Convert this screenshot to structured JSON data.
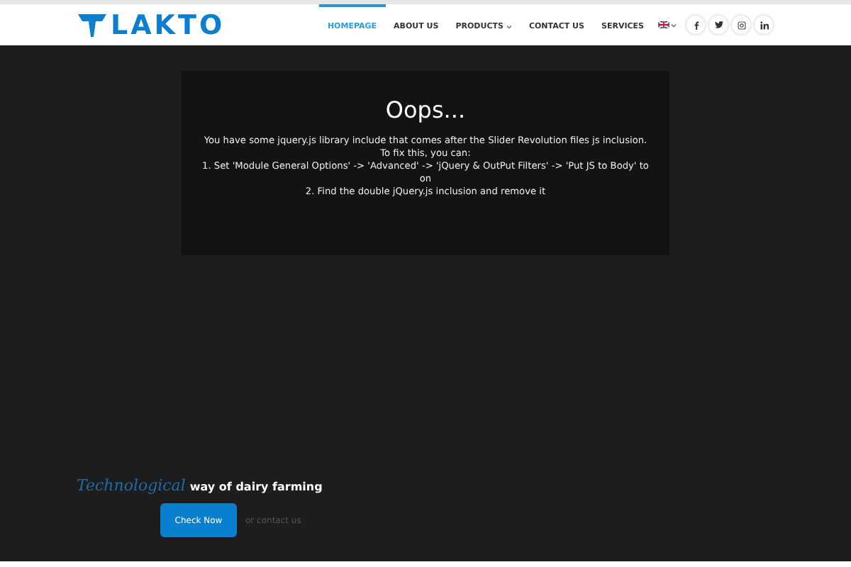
{
  "logo": {
    "text": "LAKTO"
  },
  "nav": [
    {
      "label": "HOMEPAGE",
      "selected": true,
      "dropdown": false
    },
    {
      "label": "ABOUT US",
      "selected": false,
      "dropdown": false
    },
    {
      "label": "PRODUCTS",
      "selected": false,
      "dropdown": true
    },
    {
      "label": "CONTACT US",
      "selected": false,
      "dropdown": false
    },
    {
      "label": "SERVICES",
      "selected": false,
      "dropdown": false
    }
  ],
  "social": [
    {
      "kind": "facebook"
    },
    {
      "kind": "twitter"
    },
    {
      "kind": "instagram"
    },
    {
      "kind": "linkedin"
    }
  ],
  "error": {
    "title": "Oops...",
    "lines": [
      "You have some jquery.js library include that comes after the Slider Revolution files js inclusion.",
      "To fix this, you can:",
      "1. Set 'Module General Options' -> 'Advanced' -> 'jQuery & OutPut Filters' -> 'Put JS to Body' to on",
      "2. Find the double jQuery.js inclusion and remove it"
    ]
  },
  "hero": {
    "accent": "Technological",
    "tagline": "way of dairy farming",
    "button": "Check Now",
    "link": "or contact us"
  }
}
